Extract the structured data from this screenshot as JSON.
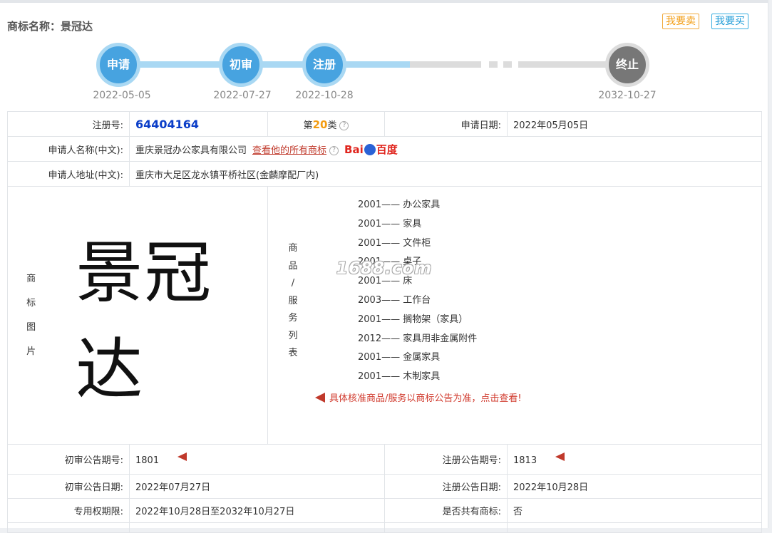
{
  "header": {
    "title": "商标名称：景冠达",
    "sell_button": "我要卖",
    "buy_button": "我要买"
  },
  "timeline": [
    {
      "label": "申请",
      "date": "2022-05-05"
    },
    {
      "label": "初审",
      "date": "2022-07-27"
    },
    {
      "label": "注册",
      "date": "2022-10-28"
    },
    {
      "label": "终止",
      "date": "2032-10-27"
    }
  ],
  "info": {
    "reg_no_label": "注册号:",
    "reg_no": "64404164",
    "class_prefix": "第",
    "class_no": "20",
    "class_suffix": "类",
    "apply_date_label": "申请日期:",
    "apply_date": "2022年05月05日",
    "applicant_label": "申请人名称(中文):",
    "applicant": "重庆景冠办公家具有限公司",
    "applicant_link": "查看他的所有商标",
    "baidu_a": "Bai",
    "baidu_b": "百度",
    "address_label": "申请人地址(中文):",
    "address": "重庆市大足区龙水镇平桥社区(金麟摩配厂内)",
    "image_label": [
      "商",
      "标",
      "图",
      "片"
    ],
    "mark_text": "景冠达",
    "goods_label": [
      "商",
      "品",
      "/",
      "服",
      "务",
      "列",
      "表"
    ],
    "goods": [
      "2001—— 办公家具",
      "2001—— 家具",
      "2001—— 文件柜",
      "2001—— 桌子",
      "2001—— 床",
      "2003—— 工作台",
      "2001—— 搁物架（家具）",
      "2012—— 家具用非金属附件",
      "2001—— 金属家具",
      "2001—— 木制家具"
    ],
    "goods_notice": "具体核准商品/服务以商标公告为准，点击查看!",
    "prelim_no_label": "初审公告期号:",
    "prelim_no": "1801",
    "reg_notice_no_label": "注册公告期号:",
    "reg_notice_no": "1813",
    "prelim_date_label": "初审公告日期:",
    "prelim_date": "2022年07月27日",
    "reg_notice_date_label": "注册公告日期:",
    "reg_notice_date": "2022年10月28日",
    "term_label": "专用权期限:",
    "term": "2022年10月28日至2032年10月27日",
    "shared_label": "是否共有商标:",
    "shared": "否"
  },
  "watermark": "1688.com"
}
